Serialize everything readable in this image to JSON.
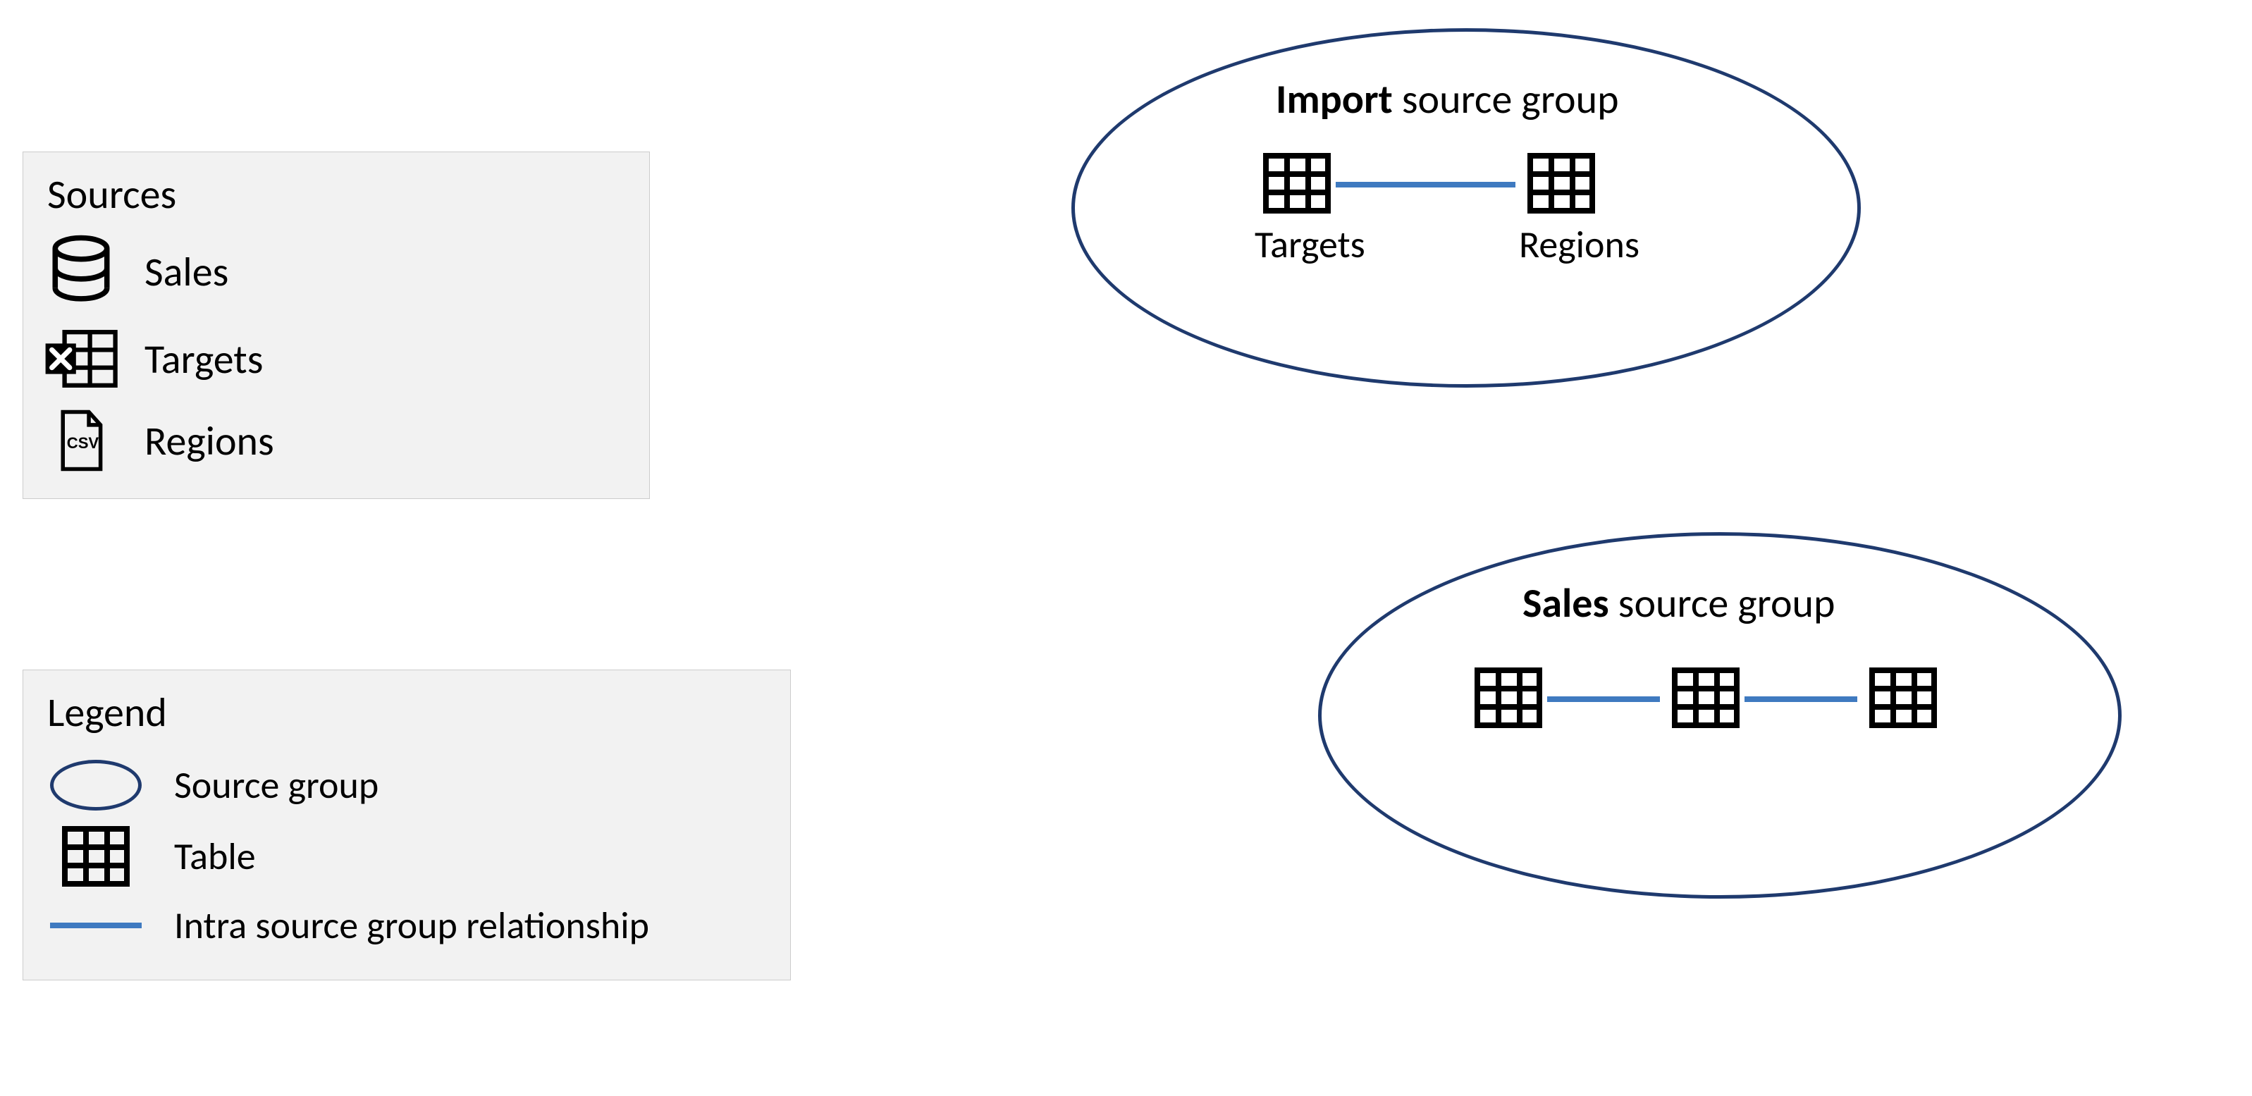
{
  "sources": {
    "title": "Sources",
    "items": [
      {
        "label": "Sales",
        "icon": "database-icon"
      },
      {
        "label": "Targets",
        "icon": "excel-icon"
      },
      {
        "label": "Regions",
        "icon": "csv-file-icon"
      }
    ]
  },
  "legend": {
    "title": "Legend",
    "items": [
      {
        "label": "Source group",
        "symbol": "ellipse"
      },
      {
        "label": "Table",
        "symbol": "table-icon"
      },
      {
        "label": "Intra source group relationship",
        "symbol": "line"
      }
    ]
  },
  "groups": {
    "import": {
      "title_bold": "Import",
      "title_rest": "source group",
      "tables": [
        {
          "label": "Targets"
        },
        {
          "label": "Regions"
        }
      ]
    },
    "sales": {
      "title_bold": "Sales",
      "title_rest": "source group",
      "tables": [
        {
          "label": ""
        },
        {
          "label": ""
        },
        {
          "label": ""
        }
      ]
    }
  },
  "colors": {
    "ellipse_border": "#1f3a6e",
    "connector": "#3f7ac0",
    "panel_bg": "#f2f2f2"
  }
}
